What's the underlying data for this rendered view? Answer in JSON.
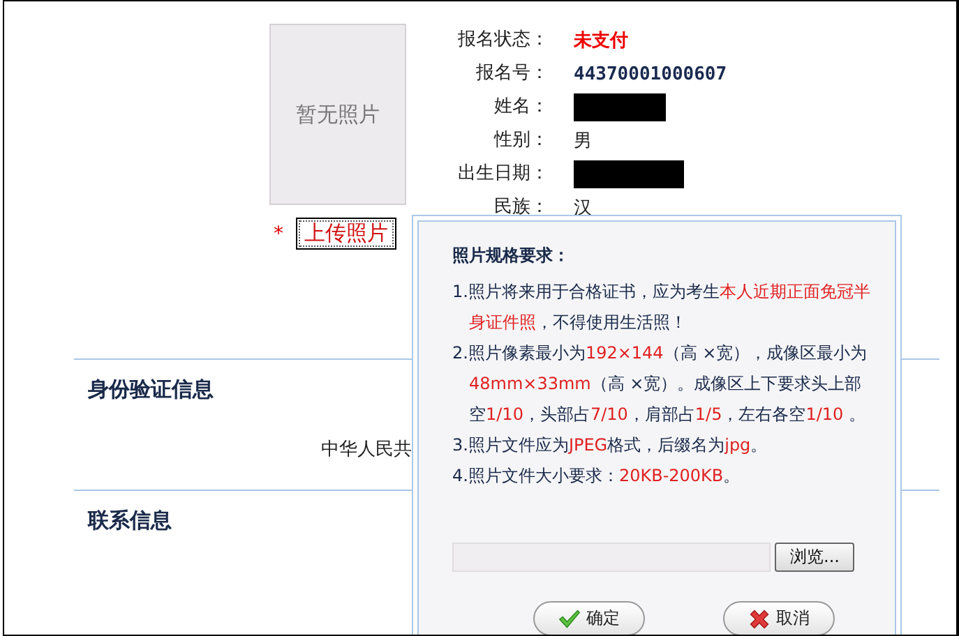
{
  "photo": {
    "placeholder": "暂无照片"
  },
  "upload": {
    "required_mark": "*",
    "label": "上传照片"
  },
  "fields": [
    {
      "label": "报名状态：",
      "value": "未支付",
      "kind": "alert"
    },
    {
      "label": "报名号：",
      "value": "44370001000607",
      "kind": "code"
    },
    {
      "label": "姓名：",
      "kind": "redacted"
    },
    {
      "label": "性别：",
      "value": "男",
      "kind": "text"
    },
    {
      "label": "出生日期：",
      "kind": "redacted"
    },
    {
      "label": "民族：",
      "value": "汉",
      "kind": "text"
    }
  ],
  "sections": [
    {
      "title": "身份验证信息",
      "text": "中华人民共"
    },
    {
      "title": "联系信息"
    }
  ],
  "dialog": {
    "title": "照片规格要求：",
    "items": [
      [
        {
          "text": "1.照片将来用于合格证书，应为考生",
          "emphasis": false
        },
        {
          "text": "本人近期正面免冠半身证件照",
          "emphasis": true
        },
        {
          "text": "，不得使用生活照！",
          "emphasis": false
        }
      ],
      [
        {
          "text": "2.照片像素最小为",
          "emphasis": false
        },
        {
          "text": "192×144",
          "emphasis": true
        },
        {
          "text": "（高 ×宽），成像区最小为",
          "emphasis": false
        },
        {
          "text": "48mm×33mm",
          "emphasis": true
        },
        {
          "text": "（高 ×宽）。成像区上下要求头上部空",
          "emphasis": false
        },
        {
          "text": "1/10",
          "emphasis": true
        },
        {
          "text": "，头部占",
          "emphasis": false
        },
        {
          "text": "7/10",
          "emphasis": true
        },
        {
          "text": "，肩部占",
          "emphasis": false
        },
        {
          "text": "1/5",
          "emphasis": true
        },
        {
          "text": "，左右各空",
          "emphasis": false
        },
        {
          "text": "1/10",
          "emphasis": true
        },
        {
          "text": " 。",
          "emphasis": false
        }
      ],
      [
        {
          "text": "3.照片文件应为",
          "emphasis": false
        },
        {
          "text": "JPEG",
          "emphasis": true
        },
        {
          "text": "格式，后缀名为",
          "emphasis": false
        },
        {
          "text": "jpg",
          "emphasis": true
        },
        {
          "text": "。",
          "emphasis": false
        }
      ],
      [
        {
          "text": "4.照片文件大小要求：",
          "emphasis": false
        },
        {
          "text": "20KB-200KB",
          "emphasis": true
        },
        {
          "text": "。",
          "emphasis": false
        }
      ]
    ],
    "browse": "浏览...",
    "buttons": [
      {
        "label": "确定",
        "kind": "ok"
      },
      {
        "label": "取消",
        "kind": "cancel"
      }
    ]
  }
}
